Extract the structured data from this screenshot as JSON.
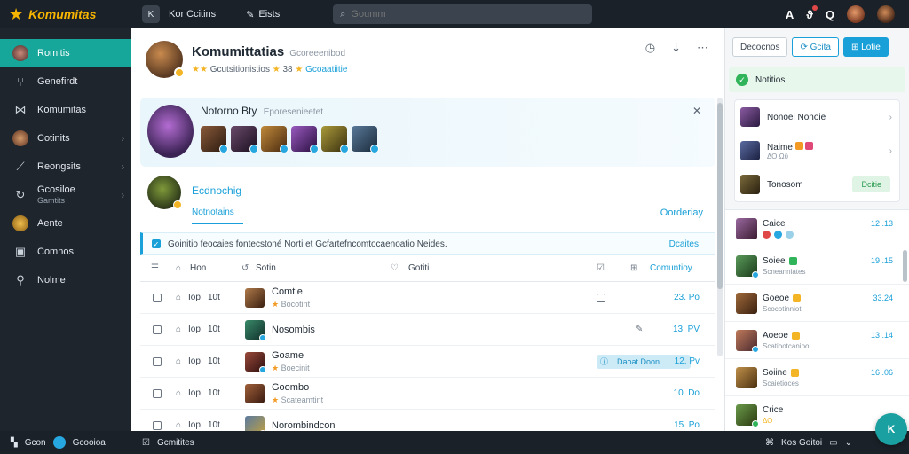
{
  "brand": "Komumitas",
  "topbar": {
    "box_label": "K",
    "app_label": "Kor Ccitins",
    "link_label": "Eists",
    "search_placeholder": "Goumm",
    "icons": [
      "A",
      "ϑ",
      "Q"
    ]
  },
  "sidebar": {
    "items": [
      {
        "label": "Romitis",
        "icon": "avatar"
      },
      {
        "label": "Genefirdt",
        "icon": "branch-icon"
      },
      {
        "label": "Komumitas",
        "icon": "network-icon"
      },
      {
        "label": "Cotinits",
        "icon": "avatar"
      },
      {
        "label": "Reongsits",
        "icon": "chart-icon"
      },
      {
        "label": "Gcosiloe",
        "sub": "Gamtits",
        "icon": "refresh-icon"
      },
      {
        "label": "Aente",
        "icon": "avatar"
      },
      {
        "label": "Comnos",
        "icon": "image-icon"
      },
      {
        "label": "Nolme",
        "icon": "person-icon"
      }
    ]
  },
  "profile": {
    "title": "Komumittatias",
    "subtitle": "Gcoreeenibod",
    "meta_left": "Gcutsitionistios",
    "meta_count": "38",
    "meta_right": "Gcoaatiitie"
  },
  "featured": {
    "title": "Notorno Bty",
    "subtitle": "Eporesenieetet"
  },
  "section": {
    "title": "Ecdnochig",
    "tab": "Notnotains",
    "right": "Oorderiay"
  },
  "notice": {
    "text": "Goinitio feocaies fontecstoné Norti et Gcfartefncomtocaenoatio Neides.",
    "right": "Dcaites"
  },
  "table": {
    "headers": {
      "c1": "Hon",
      "c2": "Sotin",
      "c3": "Gotiti",
      "c4": "Comuntioy"
    },
    "rows": [
      {
        "t1": "Iop",
        "t2": "10t",
        "name": "Comtie",
        "sub": "Bocotint",
        "val": "23. Po"
      },
      {
        "t1": "Iop",
        "t2": "10t",
        "name": "Nosombis",
        "sub": "",
        "val": "13. PV"
      },
      {
        "t1": "Iop",
        "t2": "10t",
        "name": "Goame",
        "sub": "Boecinit",
        "val": "12. Pv",
        "pill": "Daoat Doon"
      },
      {
        "t1": "Iop",
        "t2": "10t",
        "name": "Goombo",
        "sub": "Scateamtint",
        "val": "10. Do"
      },
      {
        "t1": "Iop",
        "t2": "10t",
        "name": "Norombindcon",
        "sub": "",
        "val": "15. Po"
      }
    ]
  },
  "right": {
    "buttons": [
      "Decocnos",
      "Gcita",
      "Lotie"
    ],
    "notif": "Notitios",
    "card": [
      {
        "name": "Nonoei Nonoie",
        "sub": ""
      },
      {
        "name": "Naime",
        "sub": "ΔΟ Ωϋ"
      },
      {
        "name": "Tonosom",
        "sub": "",
        "pill": "Dcitie"
      }
    ],
    "list": [
      {
        "name": "Caice",
        "sub": "",
        "val": "12 .13"
      },
      {
        "name": "Soiee",
        "sub": "Scneanniates",
        "val": "19 .15"
      },
      {
        "name": "Goeoe",
        "sub": "Scocotinniot",
        "val": "33.24"
      },
      {
        "name": "Aoeoe",
        "sub": "Scatiootcanioo",
        "val": "13 .14"
      },
      {
        "name": "Soiine",
        "sub": "Scaietioces",
        "val": "16 .06"
      },
      {
        "name": "Crice",
        "sub": "ΔΟ",
        "val": ""
      }
    ]
  },
  "bottombar": {
    "left": "Gcon",
    "left2": "Gcooioa",
    "mid": "Gcmitites",
    "right": "Kos Goitoi"
  },
  "fab_label": "K",
  "colors": {
    "accent": "#16a79a",
    "brand": "#f5b400",
    "link": "#1aa0d8"
  }
}
